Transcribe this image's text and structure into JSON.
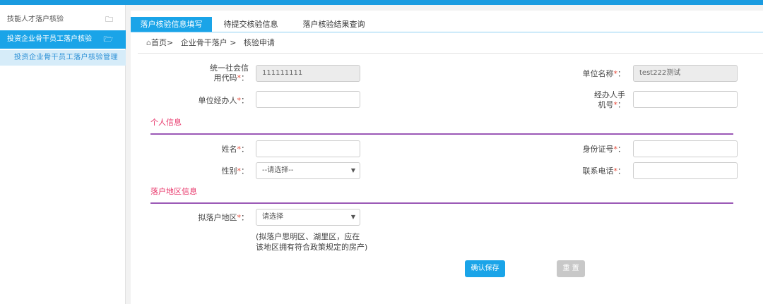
{
  "sidebar": {
    "items": [
      {
        "label": "技能人才落户核验",
        "icon": "folder-icon"
      },
      {
        "label": "投资企业骨干员工落户核验",
        "icon": "folder-open-icon",
        "active": true
      }
    ],
    "sub_item": "投资企业骨干员工落户核验管理"
  },
  "tabs": [
    {
      "label": "落户核验信息填写",
      "active": true
    },
    {
      "label": "待提交核验信息"
    },
    {
      "label": "落户核验结果查询"
    }
  ],
  "breadcrumb": {
    "home_icon": "home-icon",
    "home": "首页>",
    "level1": "企业骨干落户 >",
    "level2": "核验申请"
  },
  "form": {
    "credit_code": {
      "label_1": "统一社会信",
      "label_2": "用代码",
      "value": "111111111"
    },
    "company_name": {
      "label": "单位名称",
      "value": "test222测试"
    },
    "handler": {
      "label": "单位经办人",
      "value": ""
    },
    "handler_phone": {
      "label_1": "经办人手",
      "label_2": "机号",
      "value": ""
    },
    "section_personal": "个人信息",
    "name": {
      "label": "姓名",
      "value": ""
    },
    "id_number": {
      "label": "身份证号",
      "value": ""
    },
    "gender": {
      "label": "性别",
      "selected": "--请选择--"
    },
    "phone": {
      "label": "联系电话",
      "value": ""
    },
    "section_region": "落户地区信息",
    "region": {
      "label": "拟落户地区",
      "selected": "请选择"
    },
    "note_1": "(拟落户思明区、湖里区，应在",
    "note_2": "该地区拥有符合政策规定的房产)",
    "required_mark": "*",
    "colon": "："
  },
  "buttons": {
    "save": "确认保存",
    "reset": "重 置"
  },
  "colors": {
    "accent": "#1aa4e8",
    "section": "#e8366a",
    "divider": "#9b59b6"
  }
}
